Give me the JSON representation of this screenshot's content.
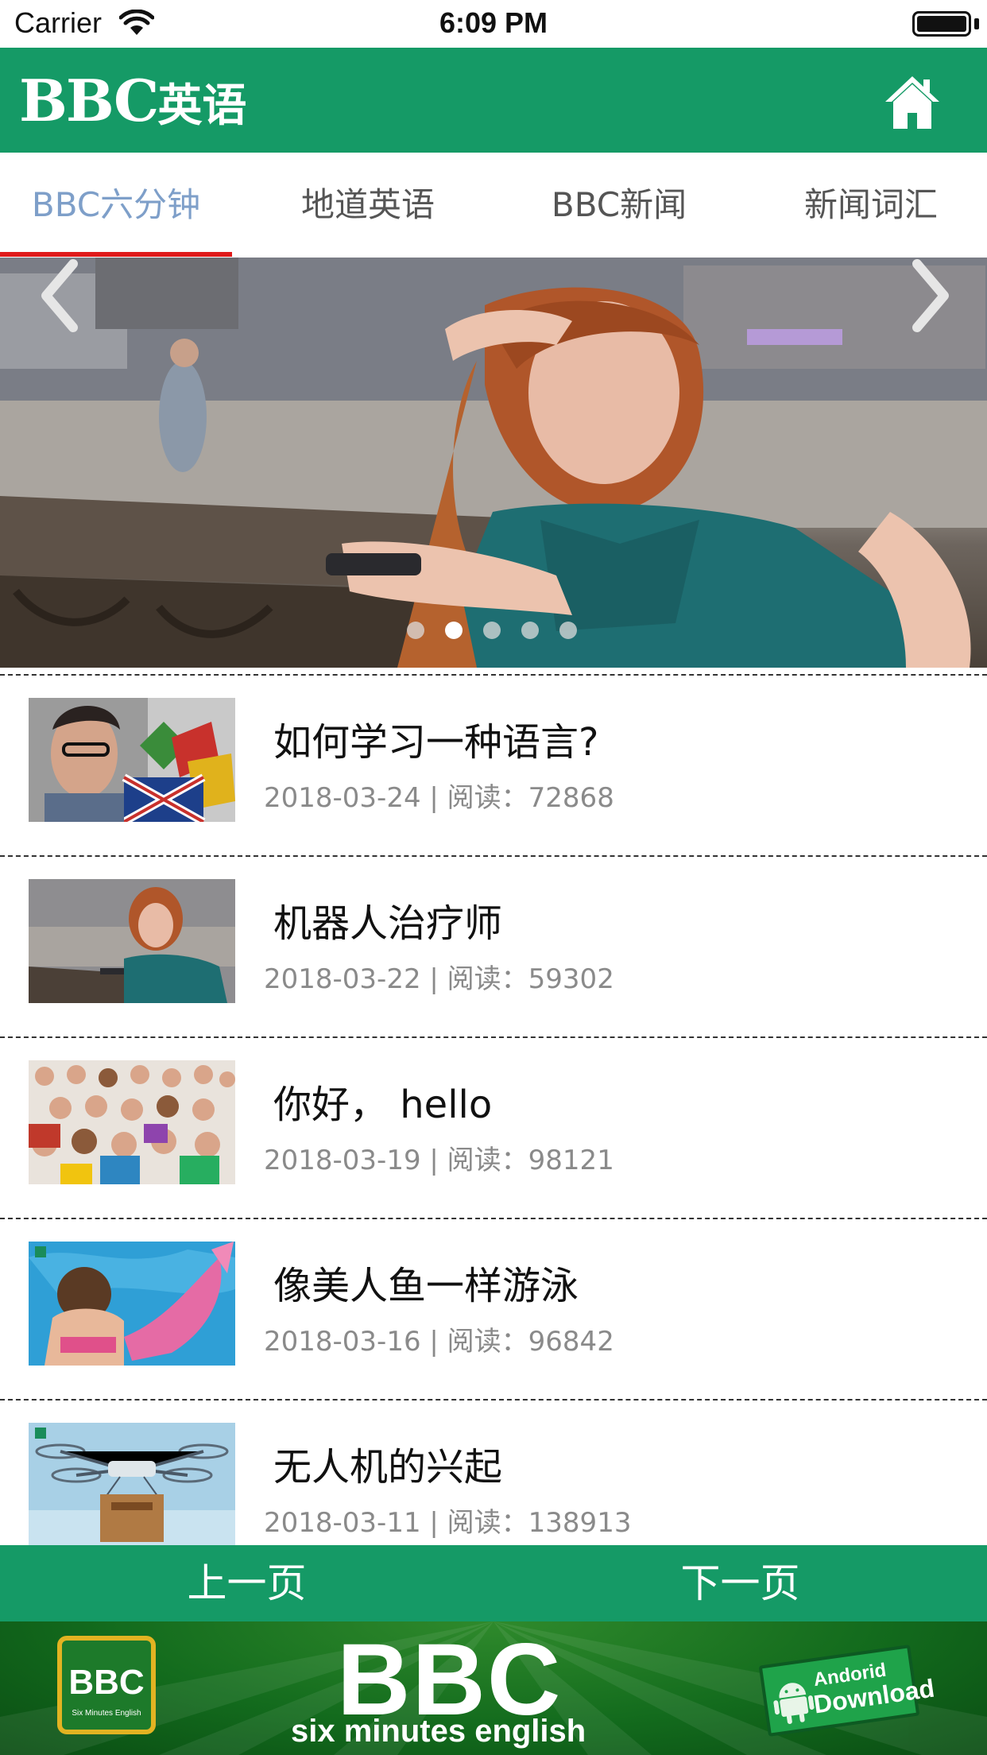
{
  "status_bar": {
    "carrier": "Carrier",
    "time": "6:09 PM"
  },
  "header": {
    "logo_latin": "BBC",
    "logo_cn": "英语",
    "home_icon": "home-icon",
    "brand_color": "#159a66"
  },
  "tabs": [
    {
      "label": "BBC六分钟",
      "active": true
    },
    {
      "label": "地道英语",
      "active": false
    },
    {
      "label": "BBC新闻",
      "active": false
    },
    {
      "label": "新闻词汇",
      "active": false
    }
  ],
  "banner": {
    "slide_count": 5,
    "active_slide": 2,
    "prev_icon": "chevron-left-icon",
    "next_icon": "chevron-right-icon"
  },
  "articles": [
    {
      "title": "如何学习一种语言?",
      "meta": "2018-03-24 | 阅读：72868"
    },
    {
      "title": "机器人治疗师",
      "meta": "2018-03-22 | 阅读：59302"
    },
    {
      "title": "你好， hello",
      "meta": "2018-03-19 | 阅读：98121"
    },
    {
      "title": "像美人鱼一样游泳",
      "meta": "2018-03-16 | 阅读：96842"
    },
    {
      "title": "无人机的兴起",
      "meta": "2018-03-11 | 阅读：138913"
    }
  ],
  "pager": {
    "prev_label": "上一页",
    "next_label": "下一页"
  },
  "ad": {
    "logo_text": "BBC",
    "logo_subtext": "Six Minutes English",
    "headline": "BBC",
    "subline": "six minutes english",
    "download_line1": "Andorid",
    "download_line2": "Download"
  }
}
